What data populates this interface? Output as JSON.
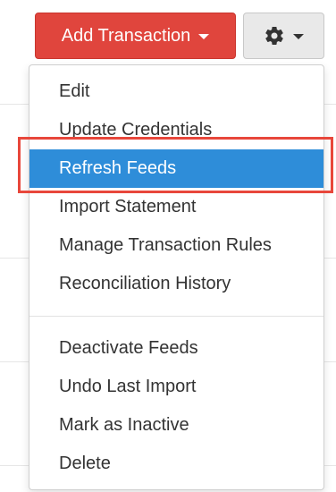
{
  "toolbar": {
    "add_transaction_label": "Add Transaction",
    "settings_icon": "gear-icon"
  },
  "menu": {
    "group1": [
      {
        "label": "Edit"
      },
      {
        "label": "Update Credentials"
      },
      {
        "label": "Refresh Feeds",
        "active": true
      },
      {
        "label": "Import Statement"
      },
      {
        "label": "Manage Transaction Rules"
      },
      {
        "label": "Reconciliation History"
      }
    ],
    "group2": [
      {
        "label": "Deactivate Feeds"
      },
      {
        "label": "Undo Last Import"
      },
      {
        "label": "Mark as Inactive"
      },
      {
        "label": "Delete"
      }
    ]
  },
  "colors": {
    "primary_button": "#e0453d",
    "active_item": "#2e8dd9",
    "highlight_box": "#e8473b"
  }
}
